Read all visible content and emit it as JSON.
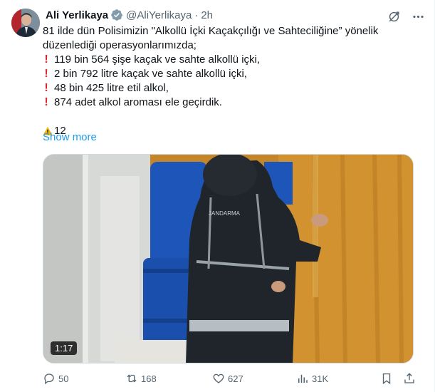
{
  "author": {
    "name": "Ali Yerlikaya",
    "handle": "@AliYerlikaya",
    "dot": "·",
    "time": "2h"
  },
  "body": {
    "intro_line1": "81 ilde dün Polisimizin \"Alkollü İçki Kaçakçılığı ve Sahteciliğine” yönelik",
    "intro_line2": "düzenlediği operasyonlarımızda;",
    "bullets": [
      "119 bin 564 şişe kaçak ve sahte alkollü içki,",
      "2 bin 792 litre kaçak ve sahte alkollü içki,",
      "48 bin 425 litre etil alkol,",
      "874 adet alkol aroması ele geçirdik."
    ],
    "bullet_mark": "❗",
    "warning_count": "12"
  },
  "show_more_label": "Show more",
  "video": {
    "duration": "1:17",
    "vest_text": "JANDARMA"
  },
  "actions": {
    "replies": "50",
    "reposts": "168",
    "likes": "627",
    "views": "31K"
  },
  "colors": {
    "accent": "#1d9bf0",
    "verified": "#829aab",
    "muted": "#536471",
    "exclamation": "#e0262e"
  },
  "icons": {
    "reply": "reply-icon",
    "repost": "repost-icon",
    "like": "heart-icon",
    "views": "analytics-icon",
    "bookmark": "bookmark-icon",
    "share": "share-icon",
    "grok": "grok-icon",
    "more": "more-icon",
    "warning": "warning-icon"
  }
}
